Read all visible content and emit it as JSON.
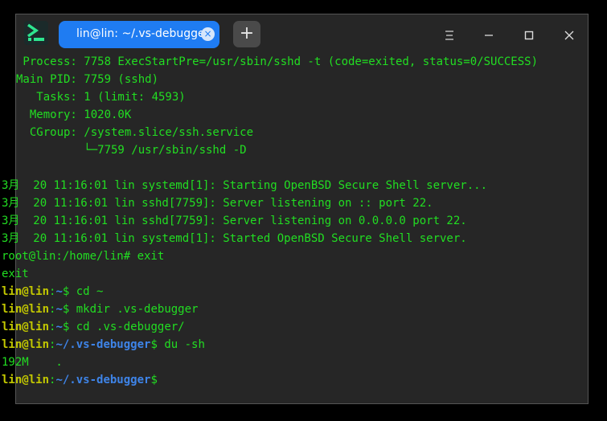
{
  "window": {
    "tab_label": "lin@lin: ~/.vs-debugger",
    "tab_close_glyph": "×",
    "new_tab_glyph": "+",
    "icons": [
      "terminal-app-icon",
      "menu-icon",
      "maximize-icon",
      "minimize-icon",
      "close-icon"
    ]
  },
  "colors": {
    "output_green": "#22dd22",
    "prompt_user": "#c2c700",
    "prompt_path": "#3e84e8",
    "tab_active": "#1f7cf2",
    "background": "#262626"
  },
  "terminal": {
    "status": [
      " Process: 7758 ExecStartPre=/usr/sbin/sshd -t (code=exited, status=0/SUCCESS)",
      "Main PID: 7759 (sshd)",
      "   Tasks: 1 (limit: 4593)",
      "  Memory: 1020.0K",
      "  CGroup: /system.slice/ssh.service",
      "          └─7759 /usr/sbin/sshd -D"
    ],
    "logs": [
      "3月  20 11:16:01 lin systemd[1]: Starting OpenBSD Secure Shell server...",
      "3月  20 11:16:01 lin sshd[7759]: Server listening on :: port 22.",
      "3月  20 11:16:01 lin sshd[7759]: Server listening on 0.0.0.0 port 22.",
      "3月  20 11:16:01 lin systemd[1]: Started OpenBSD Secure Shell server."
    ],
    "root_prompt_line": "root@lin:/home/lin# exit",
    "exit_output": "exit",
    "prompt_user": "lin@lin",
    "prompt_colon": ":",
    "prompt_sep": "$ ",
    "commands": [
      {
        "path": "~",
        "cmd": "cd ~"
      },
      {
        "path": "~",
        "cmd": "mkdir .vs-debugger"
      },
      {
        "path": "~",
        "cmd": "cd .vs-debugger/"
      },
      {
        "path": "~/.vs-debugger",
        "cmd": "du -sh"
      }
    ],
    "du_output": "192M    .",
    "final_prompt": {
      "path": "~/.vs-debugger",
      "sep": "$"
    }
  }
}
